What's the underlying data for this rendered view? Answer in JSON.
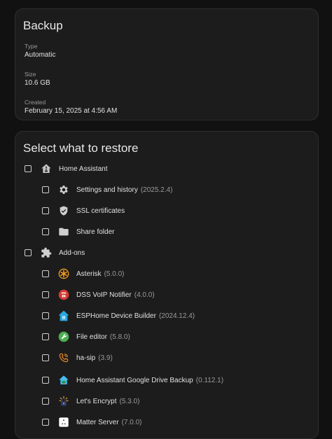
{
  "backup": {
    "title": "Backup",
    "fields": [
      {
        "label": "Type",
        "value": "Automatic"
      },
      {
        "label": "Size",
        "value": "10.6 GB"
      },
      {
        "label": "Created",
        "value": "February 15, 2025 at 4:56 AM"
      }
    ]
  },
  "restore": {
    "title": "Select what to restore",
    "home_assistant": {
      "label": "Home Assistant",
      "icon": "home-assistant-icon"
    },
    "ha_items": [
      {
        "label": "Settings and history",
        "version": "(2025.2.4)",
        "icon": "gear-icon"
      },
      {
        "label": "SSL certificates",
        "version": "",
        "icon": "shield-check-icon"
      },
      {
        "label": "Share folder",
        "version": "",
        "icon": "folder-icon"
      }
    ],
    "addons": {
      "label": "Add-ons",
      "icon": "puzzle-icon"
    },
    "addon_items": [
      {
        "label": "Asterisk",
        "version": "(5.0.0)",
        "icon": "asterisk-icon"
      },
      {
        "label": "DSS VoIP Notifier",
        "version": "(4.0.0)",
        "icon": "phone-icon"
      },
      {
        "label": "ESPHome Device Builder",
        "version": "(2024.12.4)",
        "icon": "esphome-icon"
      },
      {
        "label": "File editor",
        "version": "(5.8.0)",
        "icon": "wrench-icon"
      },
      {
        "label": "ha-sip",
        "version": "(3.9)",
        "icon": "phone-outline-icon"
      },
      {
        "label": "Home Assistant Google Drive Backup",
        "version": "(0.112.1)",
        "icon": "drive-backup-icon"
      },
      {
        "label": "Let's Encrypt",
        "version": "(5.3.0)",
        "icon": "lets-encrypt-icon"
      },
      {
        "label": "Matter Server",
        "version": "(7.0.0)",
        "icon": "matter-icon"
      }
    ]
  },
  "colors": {
    "background": "#111111",
    "card": "#1c1c1c",
    "text": "#e1e1e1",
    "secondary_text": "#9a9a9a",
    "asterisk_orange": "#f29b1d",
    "voip_red": "#d33b33",
    "esphome_blue": "#2aa8e0",
    "file_editor_green": "#4caf50",
    "ha_sip_orange": "#f08a24"
  }
}
